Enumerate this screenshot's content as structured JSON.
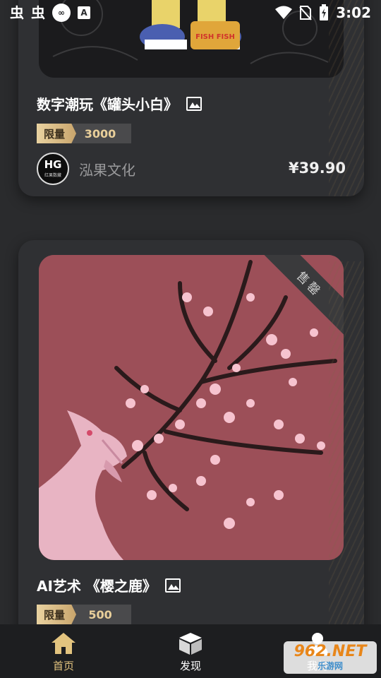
{
  "status_bar": {
    "left_icons": [
      "app-icon-1",
      "app-icon-2",
      "infinity-icon",
      "font-icon"
    ],
    "right_icons": [
      "wifi-icon",
      "no-sim-icon",
      "battery-icon"
    ],
    "time": "3:02"
  },
  "cards": [
    {
      "title": "数字潮玩《罐头小白》",
      "limit_label": "限量",
      "limit_value": "3000",
      "publisher_name": "泓果文化",
      "avatar_mark": "HG",
      "avatar_sub": "红果数藏",
      "price": "¥39.90",
      "image_text": "FISH FISH"
    },
    {
      "title": "AI艺术 《樱之鹿》",
      "limit_label": "限量",
      "limit_value": "500",
      "sold_out": "售罄"
    }
  ],
  "bottom_nav": {
    "items": [
      {
        "label": "首页",
        "icon": "home-icon",
        "active": true
      },
      {
        "label": "发现",
        "icon": "cube-icon",
        "active": false
      },
      {
        "label": "我的",
        "icon": "user-icon",
        "active": false
      }
    ],
    "active_color": "#e3c47f"
  },
  "watermark": {
    "main": "962.NET",
    "sub": "乐游网"
  },
  "colors": {
    "background": "#2a2b2d",
    "card": "#2f3033",
    "gold": "#e9cf9a",
    "artwork_background": "#9c4f58"
  }
}
